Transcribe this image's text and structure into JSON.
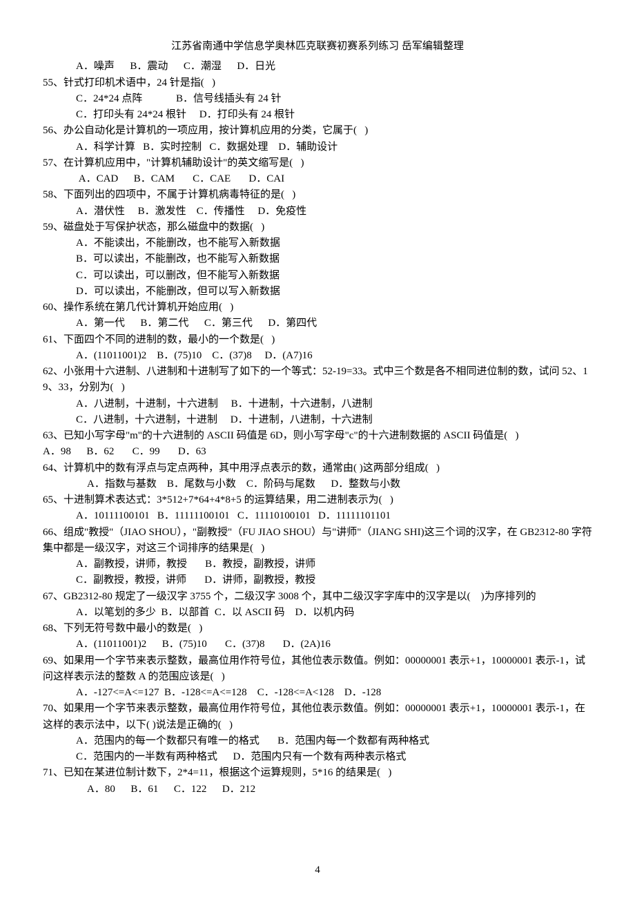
{
  "header": "江苏省南通中学信息学奥林匹克联赛初赛系列练习 岳军编辑整理",
  "page_number": "4",
  "lines": [
    {
      "cls": "indent1",
      "text": "A．噪声      B．震动      C．潮湿      D．日光"
    },
    {
      "cls": "",
      "text": "55、针式打印机术语中，24 针是指(   )"
    },
    {
      "cls": "indent1",
      "text": "C．24*24 点阵             B．信号线插头有 24 针"
    },
    {
      "cls": "indent1",
      "text": "C．打印头有 24*24 根针     D．打印头有 24 根针"
    },
    {
      "cls": "",
      "text": "56、办公自动化是计算机的一项应用，按计算机应用的分类，它属于(   )"
    },
    {
      "cls": "indent1",
      "text": "A．科学计算   B．实时控制   C．数据处理    D．辅助设计"
    },
    {
      "cls": "",
      "text": "57、在计算机应用中，\"计算机辅助设计\"的英文缩写是(   )"
    },
    {
      "cls": "indent1",
      "text": " A．CAD      B．CAM       C．CAE       D．CAI"
    },
    {
      "cls": "",
      "text": "58、下面列出的四项中，不属于计算机病毒特征的是(   )"
    },
    {
      "cls": "indent1",
      "text": "A．潜伏性     B．激发性    C．传播性     D．免疫性"
    },
    {
      "cls": "",
      "text": "59、磁盘处于写保护状态，那么磁盘中的数据(   )"
    },
    {
      "cls": "indent1",
      "text": "A．不能读出，不能删改，也不能写入新数据"
    },
    {
      "cls": "indent1",
      "text": "B．可以读出，不能删改，也不能写入新数据"
    },
    {
      "cls": "indent1",
      "text": "C．可以读出，可以删改，但不能写入新数据"
    },
    {
      "cls": "indent1",
      "text": "D．可以读出，不能删改，但可以写入新数据"
    },
    {
      "cls": "",
      "text": "60、操作系统在第几代计算机开始应用(   )"
    },
    {
      "cls": "indent1",
      "text": "A．第一代      B．第二代      C．第三代      D．第四代"
    },
    {
      "cls": "",
      "text": "61、下面四个不同的进制的数，最小的一个数是(   )"
    },
    {
      "cls": "indent1",
      "text": "A．(11011001)2    B．(75)10    C．(37)8     D．(A7)16"
    },
    {
      "cls": "",
      "text": "62、小张用十六进制、八进制和十进制写了如下的一个等式：52-19=33。式中三个数是各不相同进位制的数，试问 52、19、33，分别为(   )"
    },
    {
      "cls": "indent1",
      "text": "A．八进制，十进制，十六进制     B．十进制，十六进制，八进制"
    },
    {
      "cls": "indent1",
      "text": "C．八进制，十六进制，十进制     D．十进制，八进制，十六进制"
    },
    {
      "cls": "",
      "text": "63、已知小写字母\"m\"的十六进制的 ASCII 码值是 6D，则小写字母\"c\"的十六进制数据的 ASCII 码值是(   )"
    },
    {
      "cls": "",
      "text": "A．98      B．62       C．99       D．63"
    },
    {
      "cls": "",
      "text": "64、计算机中的数有浮点与定点两种，其中用浮点表示的数，通常由( )这两部分组成(   )"
    },
    {
      "cls": "indent2",
      "text": "A．指数与基数    B．尾数与小数    C．阶码与尾数      D．整数与小数"
    },
    {
      "cls": "",
      "text": "65、十进制算术表达式：3*512+7*64+4*8+5 的运算结果，用二进制表示为(   )"
    },
    {
      "cls": "indent1",
      "text": "A．10111100101   B．11111100101   C．11110100101   D．11111101101"
    },
    {
      "cls": "",
      "text": "66、组成\"教授\"（JIAO SHOU），\"副教授\"（FU JIAO SHOU）与\"讲师\"（JIANG SHI)这三个词的汉字，在 GB2312-80 字符集中都是一级汉字，对这三个词排序的结果是(   )"
    },
    {
      "cls": "indent1",
      "text": "A．副教授，讲师，教授       B．教授，副教授，讲师"
    },
    {
      "cls": "indent1",
      "text": "C．副教授，教授，讲师       D．讲师，副教授，教授"
    },
    {
      "cls": "",
      "text": "67、GB2312-80 规定了一级汉字 3755 个，二级汉字 3008 个，其中二级汉字字库中的汉字是以(    )为序排列的"
    },
    {
      "cls": "indent1",
      "text": "A．以笔划的多少  B．以部首  C．以 ASCII 码    D．以机内码"
    },
    {
      "cls": "",
      "text": "68、下列无符号数中最小的数是(   )"
    },
    {
      "cls": "indent1",
      "text": "A．(11011001)2      B．(75)10       C．(37)8       D．(2A)16"
    },
    {
      "cls": "",
      "text": "69、如果用一个字节来表示整数，最高位用作符号位，其他位表示数值。例如：00000001 表示+1，10000001 表示-1，试问这样表示法的整数 A 的范围应该是(   )"
    },
    {
      "cls": "indent1",
      "text": "A．-127<=A<=127  B．-128<=A<=128    C．-128<=A<128    D．-128"
    },
    {
      "cls": "",
      "text": "70、如果用一个字节来表示整数，最高位用作符号位，其他位表示数值。例如：00000001 表示+1，10000001 表示-1，在这样的表示法中，以下( )说法是正确的(   )"
    },
    {
      "cls": "indent1",
      "text": "A．范围内的每一个数都只有唯一的格式       B．范围内每一个数都有两种格式"
    },
    {
      "cls": "indent1",
      "text": "C．范围内的一半数有两种格式      D．范围内只有一个数有两种表示格式"
    },
    {
      "cls": "",
      "text": "71、已知在某进位制计数下，2*4=11，根据这个运算规则，5*16 的结果是(   )"
    },
    {
      "cls": "indent2",
      "text": "A．80      B．61      C．122      D．212"
    }
  ]
}
